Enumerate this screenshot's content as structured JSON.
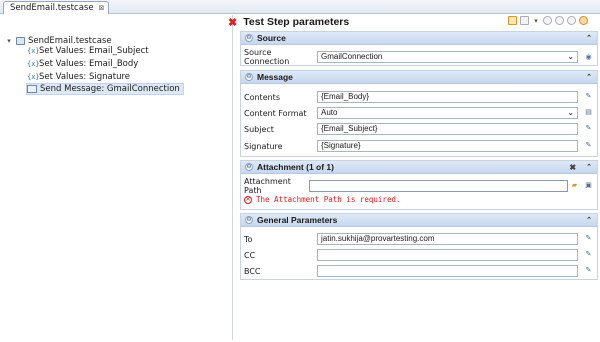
{
  "tab": {
    "title": "SendEmail.testcase",
    "close": "⊠"
  },
  "tree": {
    "root": "SendEmail.testcase",
    "items": [
      "Set Values: Email_Subject",
      "Set Values: Email_Body",
      "Set Values: Signature",
      "Send Message: GmailConnection"
    ]
  },
  "panel": {
    "title": "Test Step parameters",
    "error_glyph": "✖"
  },
  "source": {
    "header": "Source",
    "connection_label": "Source Connection",
    "connection_value": "GmailConnection"
  },
  "message": {
    "header": "Message",
    "contents_label": "Contents",
    "contents_value": "{Email_Body}",
    "format_label": "Content Format",
    "format_value": "Auto",
    "subject_label": "Subject",
    "subject_value": "{Email_Subject}",
    "signature_label": "Signature",
    "signature_value": "{Signature}"
  },
  "attachment": {
    "header": "Attachment (1 of 1)",
    "path_label": "Attachment Path",
    "path_value": "",
    "error": "The Attachment Path is required."
  },
  "general": {
    "header": "General Parameters",
    "to_label": "To",
    "to_value": "jatin.sukhija@provartesting.com",
    "cc_label": "CC",
    "cc_value": "",
    "bcc_label": "BCC",
    "bcc_value": ""
  },
  "colors": {
    "section_header": "#c6d7ee",
    "error": "#d42020",
    "selection": "#dde8f6"
  },
  "icons": [
    "chevron-down-icon",
    "test-case-icon",
    "set-values-icon",
    "send-message-icon",
    "error-icon",
    "collapse-icon",
    "remove-icon",
    "edit-icon",
    "browse-folder-icon"
  ]
}
